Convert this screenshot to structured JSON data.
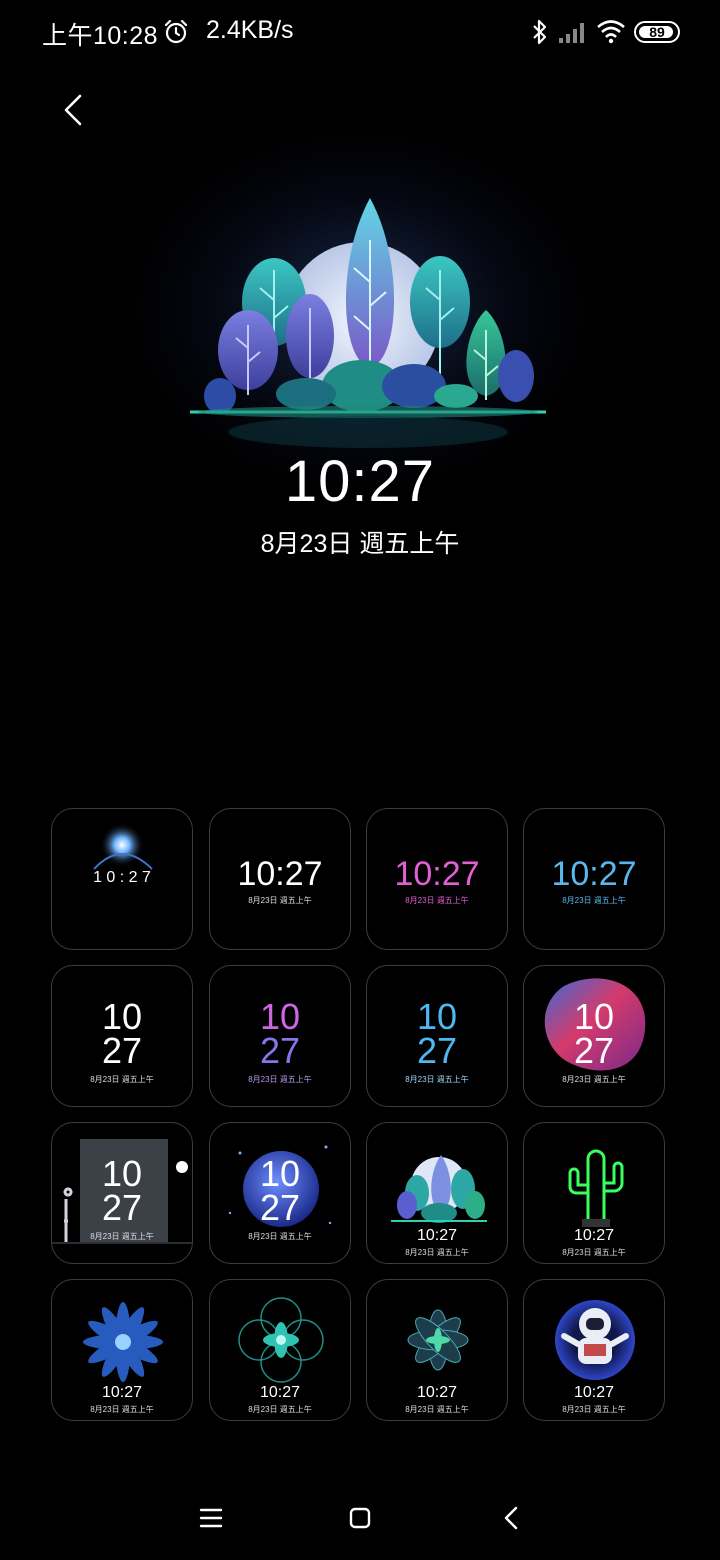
{
  "status_bar": {
    "time": "上午10:28",
    "net_speed": "2.4KB/s",
    "battery": "89",
    "icons": [
      "alarm-icon",
      "bluetooth-icon",
      "signal-icon",
      "wifi-icon",
      "battery-icon"
    ]
  },
  "preview": {
    "time": "10:27",
    "date": "8月23日 週五上午"
  },
  "tiles": [
    {
      "style": "planet",
      "time": "1 0 : 2 7",
      "color": "#ffffff"
    },
    {
      "style": "digital",
      "time": "10:27",
      "date": "8月23日 週五上午",
      "color": "#ffffff"
    },
    {
      "style": "digital",
      "time": "10:27",
      "date": "8月23日 週五上午",
      "color": "#e45fd6"
    },
    {
      "style": "digital",
      "time": "10:27",
      "date": "8月23日 週五上午",
      "color": "#5ab8f0"
    },
    {
      "style": "stacked",
      "hour": "10",
      "minute": "27",
      "date": "8月23日 週五上午",
      "color": "#ffffff"
    },
    {
      "style": "stacked",
      "hour": "10",
      "minute": "27",
      "date": "8月23日 週五上午",
      "color": "#d066e6"
    },
    {
      "style": "stacked",
      "hour": "10",
      "minute": "27",
      "date": "8月23日 週五上午",
      "color": "#4fb8f2"
    },
    {
      "style": "blob",
      "hour": "10",
      "minute": "27",
      "date": "8月23日 週五上午",
      "color": "#ffffff"
    },
    {
      "style": "door",
      "hour": "10",
      "minute": "27",
      "date": "8月23日 週五上午",
      "color": "#ffffff"
    },
    {
      "style": "moon",
      "hour": "10",
      "minute": "27",
      "date": "8月23日 週五上午",
      "color": "#ffffff"
    },
    {
      "style": "forest",
      "time": "10:27",
      "date": "8月23日 週五上午",
      "color": "#ffffff"
    },
    {
      "style": "cactus",
      "time": "10:27",
      "date": "8月23日 週五上午",
      "color": "#ffffff"
    },
    {
      "style": "flower-blue",
      "time": "10:27",
      "date": "8月23日 週五上午",
      "color": "#ffffff"
    },
    {
      "style": "flower-teal",
      "time": "10:27",
      "date": "8月23日 週五上午",
      "color": "#ffffff"
    },
    {
      "style": "flower-dark",
      "time": "10:27",
      "date": "8月23日 週五上午",
      "color": "#ffffff"
    },
    {
      "style": "astronaut",
      "time": "10:27",
      "date": "8月23日 週五上午",
      "color": "#ffffff"
    }
  ],
  "nav_bar": {
    "icons": [
      "menu-icon",
      "home-icon",
      "back-icon"
    ]
  }
}
